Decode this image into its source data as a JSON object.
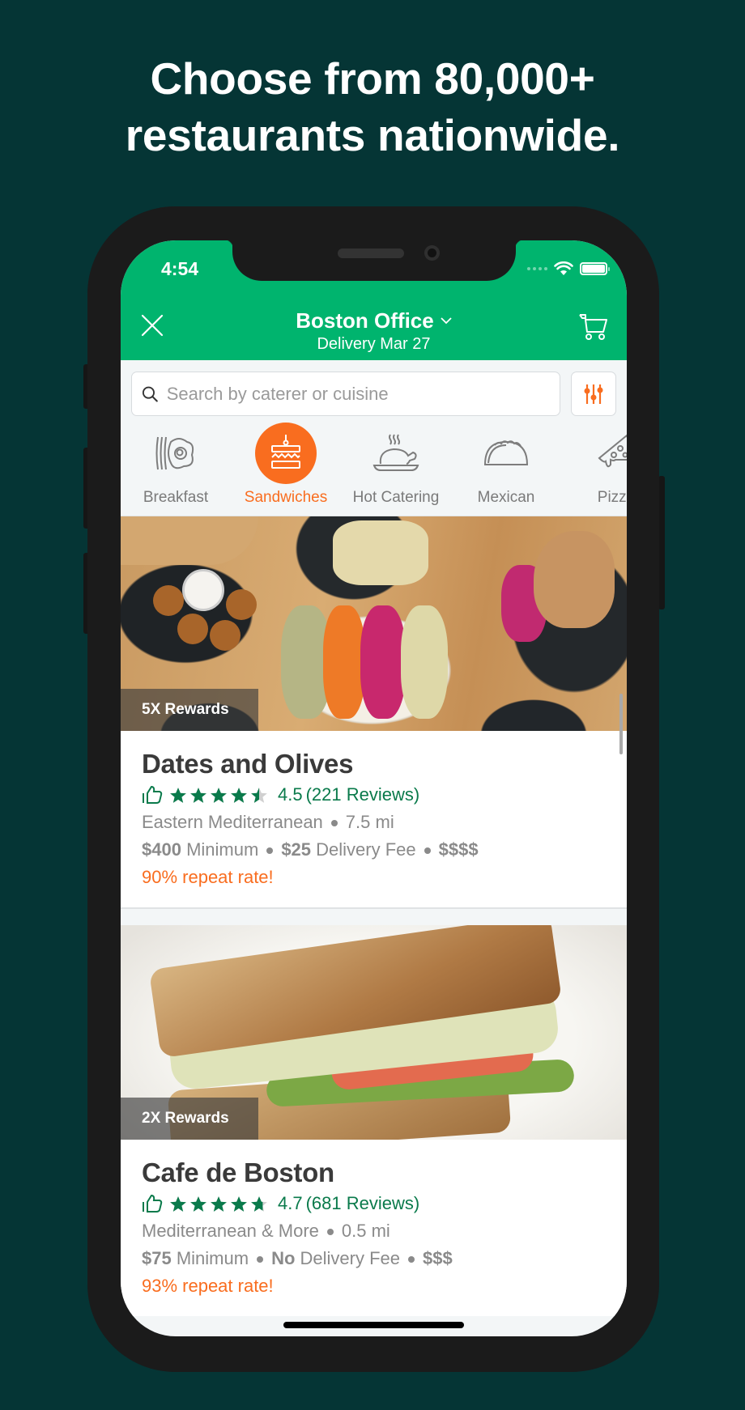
{
  "promo": {
    "headline_line1": "Choose from 80,000+",
    "headline_line2": "restaurants nationwide."
  },
  "status_bar": {
    "time": "4:54",
    "icons": [
      "cellular-signal-icon",
      "wifi-icon",
      "battery-icon"
    ]
  },
  "header": {
    "title": "Boston Office",
    "subtitle": "Delivery Mar 27",
    "close_icon": "close-icon",
    "cart_icon": "cart-icon",
    "dropdown_icon": "chevron-down-icon"
  },
  "search": {
    "placeholder": "Search by caterer or cuisine",
    "value": "",
    "filter_icon": "filter-sliders-icon"
  },
  "categories": [
    {
      "label": "Breakfast",
      "icon": "breakfast-icon",
      "active": false
    },
    {
      "label": "Sandwiches",
      "icon": "sandwich-icon",
      "active": true
    },
    {
      "label": "Hot Catering",
      "icon": "hot-catering-icon",
      "active": false
    },
    {
      "label": "Mexican",
      "icon": "taco-icon",
      "active": false
    },
    {
      "label": "Pizza",
      "icon": "pizza-icon",
      "active": false
    }
  ],
  "colors": {
    "brand_green": "#00b46e",
    "accent_orange": "#f96d1f",
    "rating_green": "#0a7a4b",
    "background": "#053535"
  },
  "restaurants": [
    {
      "reward": "5X Rewards",
      "name": "Dates and Olives",
      "rating": "4.5",
      "rating_value": 4.5,
      "reviews": "(221 Reviews)",
      "cuisine": "Eastern Mediterranean",
      "distance": "7.5 mi",
      "minimum_amount": "$400",
      "minimum_label": "Minimum",
      "fee_amount": "$25",
      "fee_label": "Delivery Fee",
      "price_level": "$$$$",
      "repeat": "90% repeat rate!"
    },
    {
      "reward": "2X Rewards",
      "name": "Cafe de Boston",
      "rating": "4.7",
      "rating_value": 4.7,
      "reviews": "(681 Reviews)",
      "cuisine": "Mediterranean & More",
      "distance": "0.5 mi",
      "minimum_amount": "$75",
      "minimum_label": "Minimum",
      "fee_amount": "No",
      "fee_label": "Delivery Fee",
      "price_level": "$$$",
      "repeat": "93% repeat rate!"
    }
  ]
}
